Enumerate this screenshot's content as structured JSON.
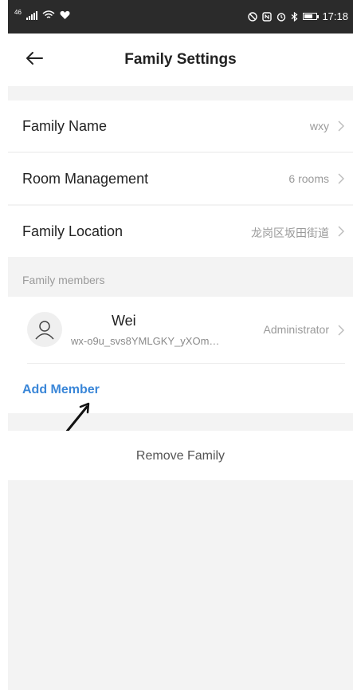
{
  "status_bar": {
    "left_text": "46",
    "time": "17:18"
  },
  "header": {
    "title": "Family Settings",
    "back_icon": "back-arrow-icon"
  },
  "settings": [
    {
      "label": "Family Name",
      "value": "wxy"
    },
    {
      "label": "Room Management",
      "value": "6 rooms"
    },
    {
      "label": "Family Location",
      "value": "龙岗区坂田街道"
    }
  ],
  "members_section": {
    "label": "Family members",
    "members": [
      {
        "name": "Wei",
        "id": "wx-o9u_svs8YMLGKY_yXOm…",
        "role": "Administrator"
      }
    ],
    "add_label": "Add Member"
  },
  "remove_label": "Remove Family",
  "colors": {
    "accent": "#3b87d8",
    "status_bar": "#2b2b2b",
    "page_bg": "#f3f3f3"
  }
}
